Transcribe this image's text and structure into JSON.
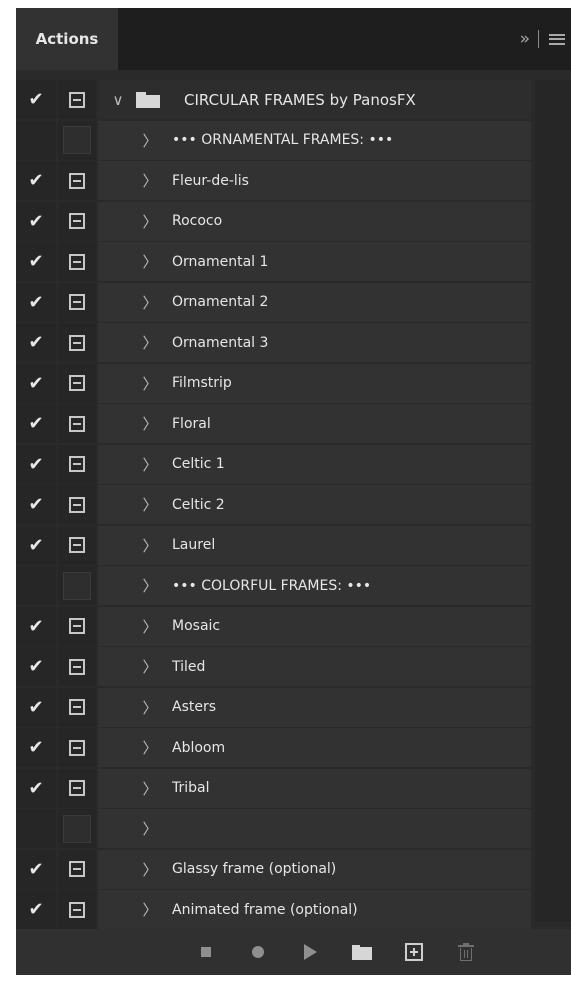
{
  "panel": {
    "tab_title": "Actions",
    "collapse_glyph": "»",
    "menu_icon": "panel-menu-icon"
  },
  "action_set": {
    "name": "CIRCULAR FRAMES by PanosFX",
    "enabled": true,
    "expanded": true
  },
  "actions": [
    {
      "name": "••• ORNAMENTAL FRAMES: •••",
      "enabled": false,
      "dialog": false
    },
    {
      "name": "Fleur-de-lis",
      "enabled": true,
      "dialog": true
    },
    {
      "name": "Rococo",
      "enabled": true,
      "dialog": true
    },
    {
      "name": "Ornamental 1",
      "enabled": true,
      "dialog": true
    },
    {
      "name": "Ornamental 2",
      "enabled": true,
      "dialog": true
    },
    {
      "name": "Ornamental 3",
      "enabled": true,
      "dialog": true
    },
    {
      "name": "Filmstrip",
      "enabled": true,
      "dialog": true
    },
    {
      "name": "Floral",
      "enabled": true,
      "dialog": true
    },
    {
      "name": "Celtic 1",
      "enabled": true,
      "dialog": true
    },
    {
      "name": "Celtic 2",
      "enabled": true,
      "dialog": true
    },
    {
      "name": "Laurel",
      "enabled": true,
      "dialog": true
    },
    {
      "name": "••• COLORFUL FRAMES: •••",
      "enabled": false,
      "dialog": false
    },
    {
      "name": "Mosaic",
      "enabled": true,
      "dialog": true
    },
    {
      "name": "Tiled",
      "enabled": true,
      "dialog": true
    },
    {
      "name": "Asters",
      "enabled": true,
      "dialog": true
    },
    {
      "name": "Abloom",
      "enabled": true,
      "dialog": true
    },
    {
      "name": "Tribal",
      "enabled": true,
      "dialog": true
    },
    {
      "name": "",
      "enabled": false,
      "dialog": false
    },
    {
      "name": "Glassy frame (optional)",
      "enabled": true,
      "dialog": true
    },
    {
      "name": "Animated frame (optional)",
      "enabled": true,
      "dialog": true
    }
  ],
  "bottom_toolbar": [
    {
      "name": "stop-playing-icon"
    },
    {
      "name": "begin-recording-icon"
    },
    {
      "name": "play-selection-icon"
    },
    {
      "name": "create-new-set-icon"
    },
    {
      "name": "create-new-action-icon"
    },
    {
      "name": "delete-icon"
    }
  ],
  "colors": {
    "panel_bg": "#2a2a2a",
    "row_bg": "#323232",
    "text": "#e6e6e6"
  }
}
